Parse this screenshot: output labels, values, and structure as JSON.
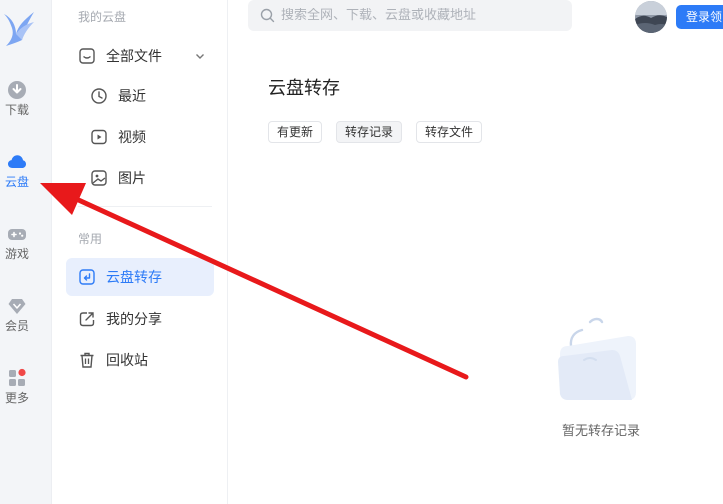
{
  "rail": {
    "items": [
      {
        "label": "下载",
        "icon": "download-icon"
      },
      {
        "label": "云盘",
        "icon": "cloud-icon"
      },
      {
        "label": "游戏",
        "icon": "gamepad-icon"
      },
      {
        "label": "会员",
        "icon": "diamond-icon"
      },
      {
        "label": "更多",
        "icon": "grid-icon"
      }
    ],
    "active": "云盘",
    "badge_color": "#f04848"
  },
  "nav": {
    "section_cloud": "我的云盘",
    "all_files": "全部文件",
    "recent": "最近",
    "video": "视频",
    "images": "图片",
    "section_common": "常用",
    "transfer": "云盘转存",
    "share": "我的分享",
    "recycle": "回收站"
  },
  "search": {
    "placeholder": "搜索全网、下载、云盘或收藏地址"
  },
  "header": {
    "login": "登录领"
  },
  "main": {
    "title": "云盘转存",
    "tabs": [
      {
        "label": "有更新"
      },
      {
        "label": "转存记录"
      },
      {
        "label": "转存文件"
      }
    ],
    "active_tab": "转存记录",
    "empty_text": "暂无转存记录"
  },
  "colors": {
    "accent": "#2d7bf7",
    "arrow": "#e8191b"
  }
}
